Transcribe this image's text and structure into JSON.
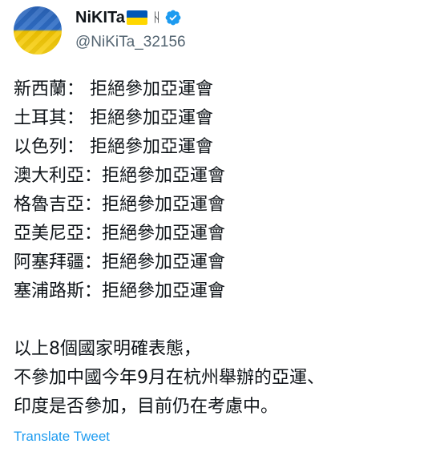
{
  "author": {
    "display_name": "NiKITa",
    "handle": "@NiKiTa_32156",
    "icons": [
      "ukraine-flag-icon",
      "rune-icon",
      "verified-badge-icon"
    ],
    "rune_glyph": "ᚺ",
    "avatar": "ukraine-flag-avatar"
  },
  "tweet": {
    "lines": [
      "新西蘭：  拒絕參加亞運會",
      "土耳其：  拒絕參加亞運會",
      "以色列：  拒絕參加亞運會",
      "澳大利亞：拒絕參加亞運會",
      "格魯吉亞：拒絕參加亞運會",
      "亞美尼亞：拒絕參加亞運會",
      "阿塞拜疆：拒絕參加亞運會",
      "塞浦路斯：拒絕參加亞運會"
    ],
    "summary_lines": [
      "以上8個國家明確表態，",
      "不參加中國今年9月在杭州舉辦的亞運、",
      "印度是否參加，目前仍在考慮中。"
    ]
  },
  "translate_label": "Translate Tweet",
  "colors": {
    "text": "#0f1419",
    "secondary": "#536471",
    "link": "#1d9bf0",
    "verified": "#1d9bf0",
    "flag_blue": "#0057b7",
    "flag_yellow": "#ffd700"
  }
}
